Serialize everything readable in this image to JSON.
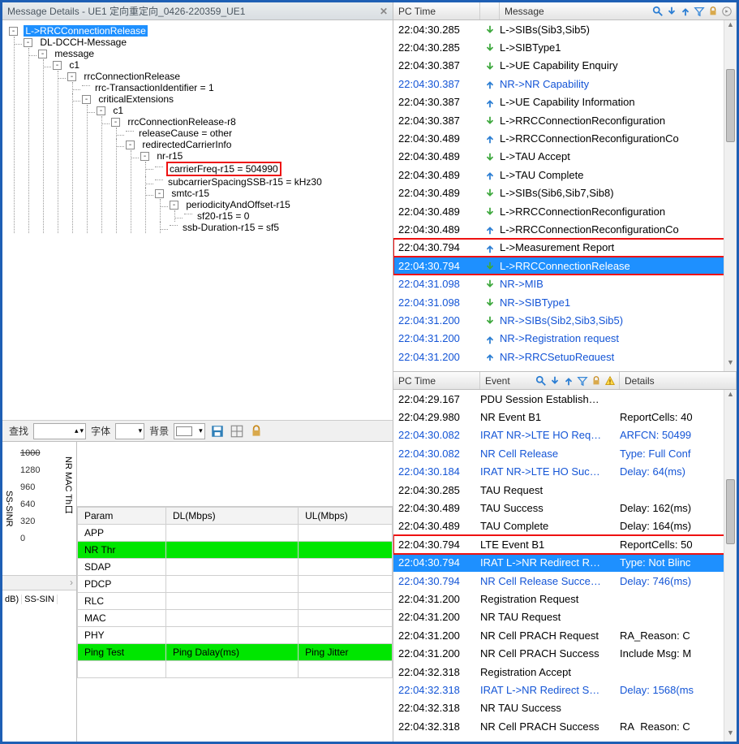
{
  "left": {
    "title": "Message Details - UE1 定向重定向_0426-220359_UE1",
    "tree": {
      "root": "L->RRCConnectionRelease",
      "n1": "DL-DCCH-Message",
      "n2": "message",
      "n3": "c1",
      "n4": "rrcConnectionRelease",
      "n4a": "rrc-TransactionIdentifier = 1",
      "n5": "criticalExtensions",
      "n6": "c1",
      "n7": "rrcConnectionRelease-r8",
      "n7a": "releaseCause = other",
      "n8": "redirectedCarrierInfo",
      "n9": "nr-r15",
      "n9a": "carrierFreq-r15 = 504990",
      "n9b": "subcarrierSpacingSSB-r15 = kHz30",
      "n10": "smtc-r15",
      "n11": "periodicityAndOffset-r15",
      "n11a": "sf20-r15 = 0",
      "n10a": "ssb-Duration-r15 = sf5"
    },
    "toolbar": {
      "find": "查找",
      "font": "字体",
      "bg": "背景"
    },
    "graph": {
      "ticks": [
        "1000",
        "1280",
        "960",
        "640",
        "320",
        "0"
      ],
      "axis1": "NR MAC Th口",
      "axis2": "SS-SINR",
      "db": "dB)",
      "ssSinr": "SS-SIN"
    },
    "paramHeaders": [
      "Param",
      "DL(Mbps)",
      "UL(Mbps)"
    ],
    "paramRows": [
      {
        "p": "APP",
        "dl": "",
        "ul": "",
        "g": false
      },
      {
        "p": "NR Thr",
        "dl": "",
        "ul": "",
        "g": true
      },
      {
        "p": "SDAP",
        "dl": "",
        "ul": "",
        "g": false
      },
      {
        "p": "PDCP",
        "dl": "",
        "ul": "",
        "g": false
      },
      {
        "p": "RLC",
        "dl": "",
        "ul": "",
        "g": false
      },
      {
        "p": "MAC",
        "dl": "",
        "ul": "",
        "g": false
      },
      {
        "p": "PHY",
        "dl": "",
        "ul": "",
        "g": false
      }
    ],
    "paramFoot": {
      "p": "Ping Test",
      "dl": "Ping Dalay(ms)",
      "ul": "Ping Jitter"
    }
  },
  "msgHeaders": {
    "time": "PC Time",
    "msg": "Message"
  },
  "messages": [
    {
      "t": "22:04:30.285",
      "d": "dn",
      "m": "L->SIBs(Sib3,Sib5)",
      "c": ""
    },
    {
      "t": "22:04:30.285",
      "d": "dn",
      "m": "L->SIBType1",
      "c": ""
    },
    {
      "t": "22:04:30.387",
      "d": "dn",
      "m": "L->UE Capability Enquiry",
      "c": ""
    },
    {
      "t": "22:04:30.387",
      "d": "up",
      "m": "NR->NR Capability",
      "c": "blue"
    },
    {
      "t": "22:04:30.387",
      "d": "up",
      "m": "L->UE Capability Information",
      "c": ""
    },
    {
      "t": "22:04:30.387",
      "d": "dn",
      "m": "L->RRCConnectionReconfiguration",
      "c": ""
    },
    {
      "t": "22:04:30.489",
      "d": "up",
      "m": "L->RRCConnectionReconfigurationCo",
      "c": ""
    },
    {
      "t": "22:04:30.489",
      "d": "dn",
      "m": "L->TAU Accept",
      "c": ""
    },
    {
      "t": "22:04:30.489",
      "d": "up",
      "m": "L->TAU Complete",
      "c": ""
    },
    {
      "t": "22:04:30.489",
      "d": "dn",
      "m": "L->SIBs(Sib6,Sib7,Sib8)",
      "c": ""
    },
    {
      "t": "22:04:30.489",
      "d": "dn",
      "m": "L->RRCConnectionReconfiguration",
      "c": ""
    },
    {
      "t": "22:04:30.489",
      "d": "up",
      "m": "L->RRCConnectionReconfigurationCo",
      "c": ""
    },
    {
      "t": "22:04:30.794",
      "d": "up",
      "m": "L->Measurement Report",
      "c": "boxed"
    },
    {
      "t": "22:04:30.794",
      "d": "dn",
      "m": "L->RRCConnectionRelease",
      "c": "sel boxed"
    },
    {
      "t": "22:04:31.098",
      "d": "dn",
      "m": "NR->MIB",
      "c": "blue"
    },
    {
      "t": "22:04:31.098",
      "d": "dn",
      "m": "NR->SIBType1",
      "c": "blue"
    },
    {
      "t": "22:04:31.200",
      "d": "dn",
      "m": "NR->SIBs(Sib2,Sib3,Sib5)",
      "c": "blue"
    },
    {
      "t": "22:04:31.200",
      "d": "up",
      "m": "NR->Registration request",
      "c": "blue"
    },
    {
      "t": "22:04:31.200",
      "d": "up",
      "m": "NR->RRCSetupRequest",
      "c": "blue"
    }
  ],
  "evHeaders": {
    "time": "PC Time",
    "event": "Event",
    "det": "Details"
  },
  "events": [
    {
      "t": "22:04:29.167",
      "e": "PDU Session Establish…",
      "d": "",
      "c": ""
    },
    {
      "t": "22:04:29.980",
      "e": "NR Event B1",
      "d": "ReportCells: 40",
      "c": ""
    },
    {
      "t": "22:04:30.082",
      "e": "IRAT NR->LTE HO Req…",
      "d": "ARFCN: 50499",
      "c": "blue"
    },
    {
      "t": "22:04:30.082",
      "e": "NR Cell Release",
      "d": "Type: Full Conf",
      "c": "blue"
    },
    {
      "t": "22:04:30.184",
      "e": "IRAT NR->LTE HO Suc…",
      "d": "Delay: 64(ms)",
      "c": "blue"
    },
    {
      "t": "22:04:30.285",
      "e": "TAU Request",
      "d": "",
      "c": ""
    },
    {
      "t": "22:04:30.489",
      "e": "TAU Success",
      "d": "Delay: 162(ms)",
      "c": ""
    },
    {
      "t": "22:04:30.489",
      "e": "TAU Complete",
      "d": "Delay: 164(ms)",
      "c": ""
    },
    {
      "t": "22:04:30.794",
      "e": "LTE Event B1",
      "d": "ReportCells: 50",
      "c": "boxed"
    },
    {
      "t": "22:04:30.794",
      "e": "IRAT L->NR Redirect R…",
      "d": "Type: Not Blinc",
      "c": "sel"
    },
    {
      "t": "22:04:30.794",
      "e": "NR Cell Release Succe…",
      "d": "Delay: 746(ms)",
      "c": "blue"
    },
    {
      "t": "22:04:31.200",
      "e": "Registration Request",
      "d": "",
      "c": ""
    },
    {
      "t": "22:04:31.200",
      "e": "NR TAU Request",
      "d": "",
      "c": ""
    },
    {
      "t": "22:04:31.200",
      "e": "NR Cell PRACH Request",
      "d": "RA_Reason: C",
      "c": ""
    },
    {
      "t": "22:04:31.200",
      "e": "NR Cell PRACH Success",
      "d": "Include Msg: M",
      "c": ""
    },
    {
      "t": "22:04:32.318",
      "e": "Registration Accept",
      "d": "",
      "c": ""
    },
    {
      "t": "22:04:32.318",
      "e": "IRAT L->NR Redirect S…",
      "d": "Delay: 1568(ms",
      "c": "blue"
    },
    {
      "t": "22:04:32.318",
      "e": "NR TAU Success",
      "d": "",
      "c": ""
    },
    {
      "t": "22:04:32.318",
      "e": "NR Cell PRACH Success",
      "d": "RA_Reason: C",
      "c": ""
    }
  ]
}
